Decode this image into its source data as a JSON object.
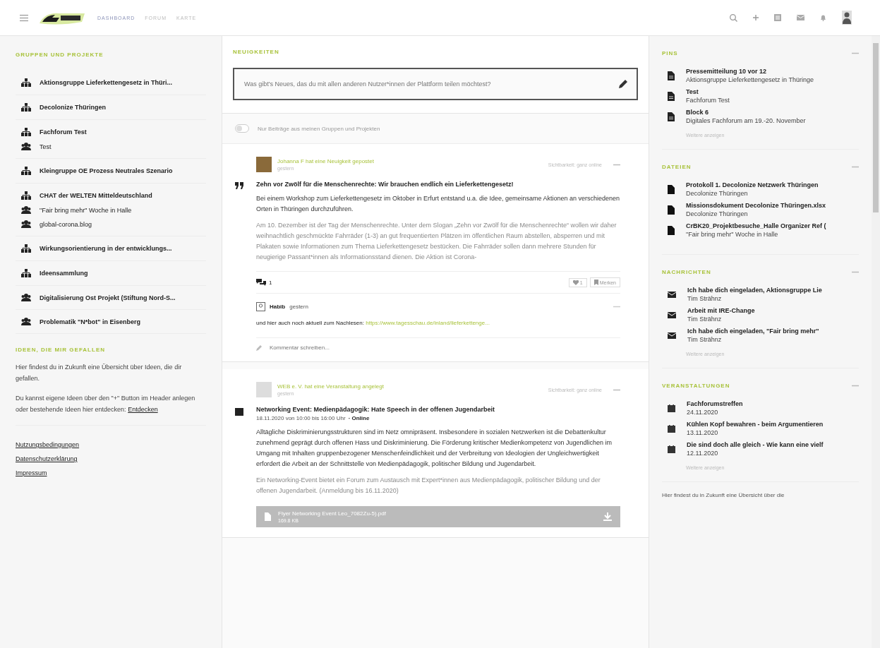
{
  "header": {
    "nav": [
      {
        "label": "DASHBOARD",
        "selected": true
      },
      {
        "label": "FORUM",
        "selected": false
      },
      {
        "label": "KARTE",
        "selected": false
      }
    ]
  },
  "sidebar": {
    "title": "GRUPPEN UND PROJEKTE",
    "groups": [
      {
        "kind": "group",
        "label": "Aktionsgruppe Lieferkettengesetz in Thüri..."
      },
      {
        "kind": "group",
        "label": "Decolonize Thüringen"
      },
      {
        "kind": "group",
        "label": "Fachforum Test",
        "children": [
          {
            "kind": "project",
            "label": "Test"
          }
        ]
      },
      {
        "kind": "group",
        "label": "Kleingruppe OE Prozess Neutrales Szenario"
      },
      {
        "kind": "group",
        "label": "CHAT der WELTEN Mitteldeutschland",
        "children": [
          {
            "kind": "project",
            "label": "\"Fair bring mehr\" Woche in Halle"
          },
          {
            "kind": "project",
            "label": "global-corona.blog"
          }
        ]
      },
      {
        "kind": "group",
        "label": "Wirkungsorientierung in der entwicklungs..."
      },
      {
        "kind": "group",
        "label": "Ideensammlung"
      },
      {
        "kind": "project",
        "label": "Digitalisierung Ost Projekt (Stiftung Nord-S..."
      },
      {
        "kind": "project",
        "label": "Problematik \"N*bot\" in Eisenberg"
      }
    ],
    "ideas": {
      "title": "IDEEN, DIE MIR GEFALLEN",
      "text": "Hier findest du in Zukunft eine Übersicht über Ideen, die dir gefallen.",
      "hint": "Du kannst eigene Ideen über den \"+\" Button im Header anlegen oder bestehende Ideen hier entdecken:",
      "link": "Entdecken"
    },
    "footer_links": [
      "Nutzungsbedingungen",
      "Datenschutzerklärung",
      "Impressum"
    ]
  },
  "feed": {
    "title": "NEUIGKEITEN",
    "composer": {
      "placeholder": "Was gibt's Neues, das du mit allen anderen Nutzer*innen der Plattform teilen möchtest?"
    },
    "filter": {
      "label": "Nur Beiträge aus meinen Gruppen und Projekten",
      "on": false
    },
    "posts": [
      {
        "kind": "news",
        "author": "Johanna F hat eine Neuigkeit gepostet",
        "time": "gestern",
        "visibility": "Sichtbarkeit: ganz online",
        "title": "Zehn vor Zwölf für die Menschenrechte: Wir brauchen endlich ein Lieferkettengesetz!",
        "paragraphs": [
          "Bei einem Workshop zum Lieferkettengesetz im Oktober in Erfurt entstand u.a. die Idee, gemeinsame Aktionen an verschiedenen Orten in Thüringen durchzuführen."
        ],
        "faded": [
          "Am 10. Dezember ist der Tag der Menschenrechte. Unter dem Slogan „Zehn vor Zwölf für die Menschenrechte“ wollen wir daher weihnachtlich geschmückte Fahrräder (1-3) an gut frequentierten Plätzen im öffentlichen Raum abstellen, absperren und mit Plakaten sowie Informationen zum Thema Lieferkettengesetz bestücken. Die Fahrräder sollen dann mehrere Stunden für neugierige Passant*innen als Informationsstand dienen. Die Aktion ist Corona-"
        ],
        "comments_count": "1",
        "likes": "1",
        "action": "Merken",
        "comment": {
          "author": "Habib",
          "time": "gestern",
          "text": "und hier auch noch aktuell zum Nachlesen:",
          "link": "https://www.tagesschau.de/inland/lieferkettenge..."
        },
        "comment_placeholder": "Kommentar schreiben..."
      },
      {
        "kind": "event",
        "author": "WEB e. V. hat eine Veranstaltung angelegt",
        "time": "gestern",
        "visibility": "Sichtbarkeit: ganz online",
        "title": "Networking Event: Medienpädagogik: Hate Speech in der offenen Jugendarbeit",
        "date": "18.11.2020 von 10:00 bis 16:00 Uhr",
        "location": "· Online",
        "paragraphs": [
          "Alltägliche Diskriminierungsstrukturen sind im Netz omnipräsent. Insbesondere in sozialen Netzwerken ist die Debattenkultur zunehmend geprägt durch offenen Hass und Diskriminierung. Die Förderung kritischer Medienkompetenz von Jugendlichen im Umgang mit Inhalten gruppenbezogener Menschenfeindlichkeit und der Verbreitung von Ideologien der Ungleichwertigkeit erfordert die Arbeit an der Schnittstelle von Medienpädagogik, politischer Bildung und Jugendarbeit."
        ],
        "faded": [
          "Ein Networking-Event bietet ein Forum zum Austausch mit Expert*innen aus Medienpädagogik, politischer Bildung und der offenen Jugendarbeit. (Anmeldung bis 16.11.2020)"
        ],
        "attachment": {
          "name": "Flyer Networking Event Leo_7082Zu-5).pdf",
          "size": "169.8 KB"
        }
      }
    ]
  },
  "right": {
    "panels": [
      {
        "kind": "pins",
        "title": "PINS",
        "items": [
          {
            "title": "Pressemitteilung 10 vor 12",
            "subtitle": "Aktionsgruppe Lieferkettengesetz in Thüringe"
          },
          {
            "title": "Test",
            "subtitle": "Fachforum Test"
          },
          {
            "title": "Block 6",
            "subtitle": "Digitales Fachforum am 19.-20. November"
          }
        ],
        "more": "Weitere anzeigen"
      },
      {
        "kind": "files",
        "title": "DATEIEN",
        "items": [
          {
            "title": "Protokoll 1. Decolonize Netzwerk Thüringen",
            "subtitle": "Decolonize Thüringen"
          },
          {
            "title": "Missionsdokument Decolonize Thüringen.xlsx",
            "subtitle": "Decolonize Thüringen"
          },
          {
            "title": "CrBK20_Projektbesuche_Halle Organizer Ref (",
            "subtitle": "\"Fair bring mehr\" Woche in Halle"
          }
        ]
      },
      {
        "kind": "messages",
        "title": "NACHRICHTEN",
        "items": [
          {
            "title": "Ich habe dich eingeladen, Aktionsgruppe Lie",
            "subtitle": "Tim Strähnz"
          },
          {
            "title": "Arbeit mit IRE-Change",
            "subtitle": "Tim Strähnz"
          },
          {
            "title": "Ich habe dich eingeladen, \"Fair bring mehr\"",
            "subtitle": "Tim Strähnz"
          }
        ],
        "more": "Weitere anzeigen"
      },
      {
        "kind": "events",
        "title": "VERANSTALTUNGEN",
        "items": [
          {
            "title": "Fachforumstreffen",
            "subtitle": "24.11.2020"
          },
          {
            "title": "Kühlen Kopf bewahren - beim Argumentieren",
            "subtitle": "13.11.2020"
          },
          {
            "title": "Die sind doch alle gleich - Wie kann eine vielf",
            "subtitle": "12.11.2020"
          }
        ],
        "more": "Weitere anzeigen"
      }
    ],
    "footer_text": "Hier findest du in Zukunft eine Übersicht über die"
  }
}
